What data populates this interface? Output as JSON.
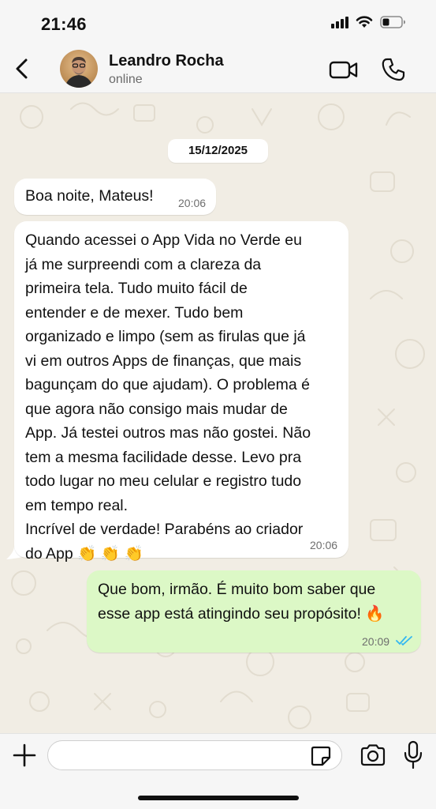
{
  "status_bar": {
    "time": "21:46",
    "icons": [
      "cellular-signal-icon",
      "wifi-icon",
      "battery-icon"
    ]
  },
  "header": {
    "contact_name": "Leandro Rocha",
    "contact_status": "online",
    "icons": [
      "back-chevron-icon",
      "video-call-icon",
      "phone-icon"
    ]
  },
  "chat": {
    "date_separator": "15/12/2025",
    "messages": [
      {
        "direction": "incoming",
        "text": "Boa noite, Mateus!",
        "time": "20:06"
      },
      {
        "direction": "incoming",
        "text": "Quando acessei o App Vida no Verde eu\njá me surpreendi com a clareza da\nprimeira tela. Tudo muito fácil de\nentender e de mexer. Tudo bem\norganizado e limpo (sem as firulas que já\nvi em outros Apps de finanças, que mais\nbagunçam do que ajudam). O problema é\nque agora não consigo mais mudar de\nApp. Já testei outros mas não gostei. Não\ntem a mesma facilidade desse. Levo pra\ntodo lugar no meu celular e registro tudo\nem tempo real.\nIncrível de verdade! Parabéns ao criador\ndo App 👏 👏 👏",
        "time": "20:06"
      },
      {
        "direction": "outgoing",
        "text": "Que bom, irmão. É muito bom saber que\nesse app está atingindo seu propósito! 🔥",
        "time": "20:09",
        "status": "read",
        "status_icon": "double-check-icon"
      }
    ]
  },
  "input_bar": {
    "placeholder": "",
    "value": "",
    "icons": [
      "plus-icon",
      "sticker-icon",
      "camera-icon",
      "microphone-icon"
    ]
  },
  "colors": {
    "outgoing_bubble": "#dcf8c6",
    "incoming_bubble": "#ffffff",
    "chat_background": "#f1ede4",
    "read_receipt": "#34b7f1"
  }
}
